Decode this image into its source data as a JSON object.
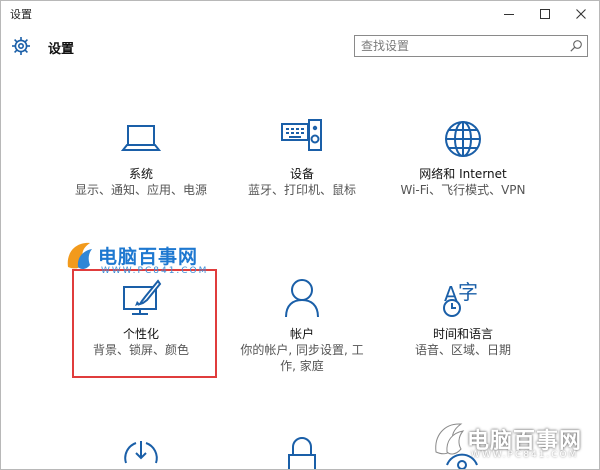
{
  "window": {
    "title": "设置"
  },
  "header": {
    "title": "设置"
  },
  "search": {
    "placeholder": "查找设置"
  },
  "accent_color": "#1a5fa8",
  "tiles": [
    {
      "name": "系统",
      "desc": "显示、通知、应用、电源",
      "icon": "laptop-icon"
    },
    {
      "name": "设备",
      "desc": "蓝牙、打印机、鼠标",
      "icon": "devices-icon"
    },
    {
      "name": "网络和 Internet",
      "desc": "Wi-Fi、飞行模式、VPN",
      "icon": "globe-icon"
    },
    {
      "name": "个性化",
      "desc": "背景、锁屏、颜色",
      "icon": "personalization-icon"
    },
    {
      "name": "帐户",
      "desc": "你的帐户, 同步设置, 工作, 家庭",
      "icon": "person-icon"
    },
    {
      "name": "时间和语言",
      "desc": "语音、区域、日期",
      "icon": "time-language-icon"
    }
  ],
  "watermark": {
    "text": "电脑百事网",
    "url": "WWW.PC841.COM"
  }
}
